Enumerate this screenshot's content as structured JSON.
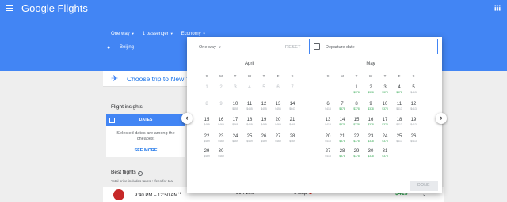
{
  "header": {
    "brand": "Google Flights"
  },
  "search": {
    "trip_type": "One way",
    "passengers": "1 passenger",
    "cabin": "Economy",
    "origin": "Beijing"
  },
  "trip_card": {
    "text": "Choose trip to New Y"
  },
  "insights": {
    "title": "Flight insights",
    "tab_label": "DATES",
    "text": "Selected dates are among the cheapest",
    "link": "SEE MORE"
  },
  "best": {
    "title": "Best flights",
    "note": "Total price includes taxes + fees for 1 a",
    "flight": {
      "times": "9:40 PM – 12:50 AM",
      "plus_day": "+2",
      "duration": "39h 10m",
      "stops": "1 stop",
      "price": "$413"
    }
  },
  "picker": {
    "trip_type": "One way",
    "reset": "RESET",
    "departure_placeholder": "Departure date",
    "done": "DONE",
    "weekdays": [
      "S",
      "M",
      "T",
      "W",
      "T",
      "F",
      "S"
    ],
    "april": {
      "name": "April",
      "weeks": [
        [
          {
            "n": "1",
            "past": true
          },
          {
            "n": "2",
            "past": true
          },
          {
            "n": "3",
            "past": true
          },
          {
            "n": "4",
            "past": true
          },
          {
            "n": "5",
            "past": true
          },
          {
            "n": "6",
            "past": true
          },
          {
            "n": "7",
            "past": true
          }
        ],
        [
          {
            "n": "8",
            "past": true
          },
          {
            "n": "9",
            "past": true
          },
          {
            "n": "10",
            "p": "$455"
          },
          {
            "n": "11",
            "p": "$455"
          },
          {
            "n": "12",
            "p": "$455"
          },
          {
            "n": "13",
            "p": "$455"
          },
          {
            "n": "14",
            "p": "$647"
          }
        ],
        [
          {
            "n": "15",
            "p": "$469"
          },
          {
            "n": "16",
            "p": "$469"
          },
          {
            "n": "17",
            "p": "$469"
          },
          {
            "n": "18",
            "p": "$469"
          },
          {
            "n": "19",
            "p": "$469"
          },
          {
            "n": "20",
            "p": "$469"
          },
          {
            "n": "21",
            "p": "$469"
          }
        ],
        [
          {
            "n": "22",
            "p": "$469"
          },
          {
            "n": "23",
            "p": "$469"
          },
          {
            "n": "24",
            "p": "$469"
          },
          {
            "n": "25",
            "p": "$469"
          },
          {
            "n": "26",
            "p": "$469"
          },
          {
            "n": "27",
            "p": "$469"
          },
          {
            "n": "28",
            "p": "$469"
          }
        ],
        [
          {
            "n": "29",
            "p": "$469"
          },
          {
            "n": "30",
            "p": "$469"
          }
        ]
      ]
    },
    "may": {
      "name": "May",
      "weeks": [
        [
          {
            "n": "1",
            "p": "$378",
            "cheap": true
          },
          {
            "n": "2",
            "p": "$378",
            "cheap": true
          },
          {
            "n": "3",
            "p": "$378",
            "cheap": true
          },
          {
            "n": "4",
            "p": "$378",
            "cheap": true
          },
          {
            "n": "5",
            "p": "$413"
          }
        ],
        [
          {
            "n": "6",
            "p": "$413"
          },
          {
            "n": "7",
            "p": "$378",
            "cheap": true
          },
          {
            "n": "8",
            "p": "$378",
            "cheap": true
          },
          {
            "n": "9",
            "p": "$378",
            "cheap": true
          },
          {
            "n": "10",
            "p": "$378",
            "cheap": true
          },
          {
            "n": "11",
            "p": "$413"
          },
          {
            "n": "12",
            "p": "$413"
          }
        ],
        [
          {
            "n": "13",
            "p": "$413"
          },
          {
            "n": "14",
            "p": "$378",
            "cheap": true
          },
          {
            "n": "15",
            "p": "$378",
            "cheap": true
          },
          {
            "n": "16",
            "p": "$378",
            "cheap": true
          },
          {
            "n": "17",
            "p": "$378",
            "cheap": true
          },
          {
            "n": "18",
            "p": "$413"
          },
          {
            "n": "19",
            "p": "$413"
          }
        ],
        [
          {
            "n": "20",
            "p": "$413"
          },
          {
            "n": "21",
            "p": "$378",
            "cheap": true
          },
          {
            "n": "22",
            "p": "$378",
            "cheap": true
          },
          {
            "n": "23",
            "p": "$378",
            "cheap": true
          },
          {
            "n": "24",
            "p": "$378",
            "cheap": true
          },
          {
            "n": "25",
            "p": "$413"
          },
          {
            "n": "26",
            "p": "$413"
          }
        ],
        [
          {
            "n": "27",
            "p": "$413"
          },
          {
            "n": "28",
            "p": "$378",
            "cheap": true
          },
          {
            "n": "29",
            "p": "$378",
            "cheap": true
          },
          {
            "n": "30",
            "p": "$378",
            "cheap": true
          },
          {
            "n": "31",
            "p": "$378",
            "cheap": true
          }
        ]
      ]
    }
  },
  "colors": {
    "brand_blue": "#4285f4",
    "cheap_green": "#34a853",
    "warning_red": "#d93025"
  }
}
